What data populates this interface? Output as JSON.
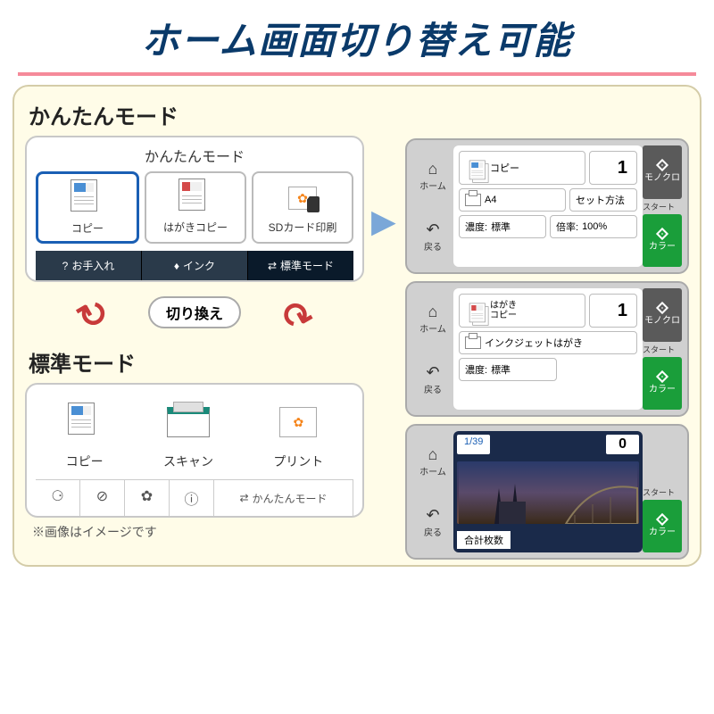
{
  "title": "ホーム画面切り替え可能",
  "easy_mode": {
    "label": "かんたんモード",
    "header": "かんたんモード",
    "tiles": [
      {
        "label": "コピー"
      },
      {
        "label": "はがきコピー"
      },
      {
        "label": "SDカード印刷"
      }
    ],
    "bottom": [
      {
        "label": "お手入れ"
      },
      {
        "label": "インク"
      },
      {
        "label": "標準モード"
      }
    ]
  },
  "switch_label": "切り換え",
  "std_mode": {
    "label": "標準モード",
    "tiles": [
      {
        "label": "コピー"
      },
      {
        "label": "スキャン"
      },
      {
        "label": "プリント"
      }
    ],
    "bottom_last": "かんたんモード"
  },
  "screens": {
    "copy": {
      "title": "コピー",
      "count": "1",
      "paper": "A4",
      "set_method": "セット方法",
      "density_label": "濃度:",
      "density_value": "標準",
      "ratio_label": "倍率:",
      "ratio_value": "100%"
    },
    "hagaki": {
      "title": "はがき\nコピー",
      "count": "1",
      "paper": "インクジェットはがき",
      "density_label": "濃度:",
      "density_value": "標準"
    },
    "photo": {
      "page": "1/39",
      "count": "0",
      "footer": "合計枚数"
    },
    "nav": {
      "home": "ホーム",
      "back": "戻る"
    },
    "buttons": {
      "mono": "モノクロ",
      "start": "スタート",
      "color": "カラー"
    }
  },
  "footnote": "※画像はイメージです"
}
